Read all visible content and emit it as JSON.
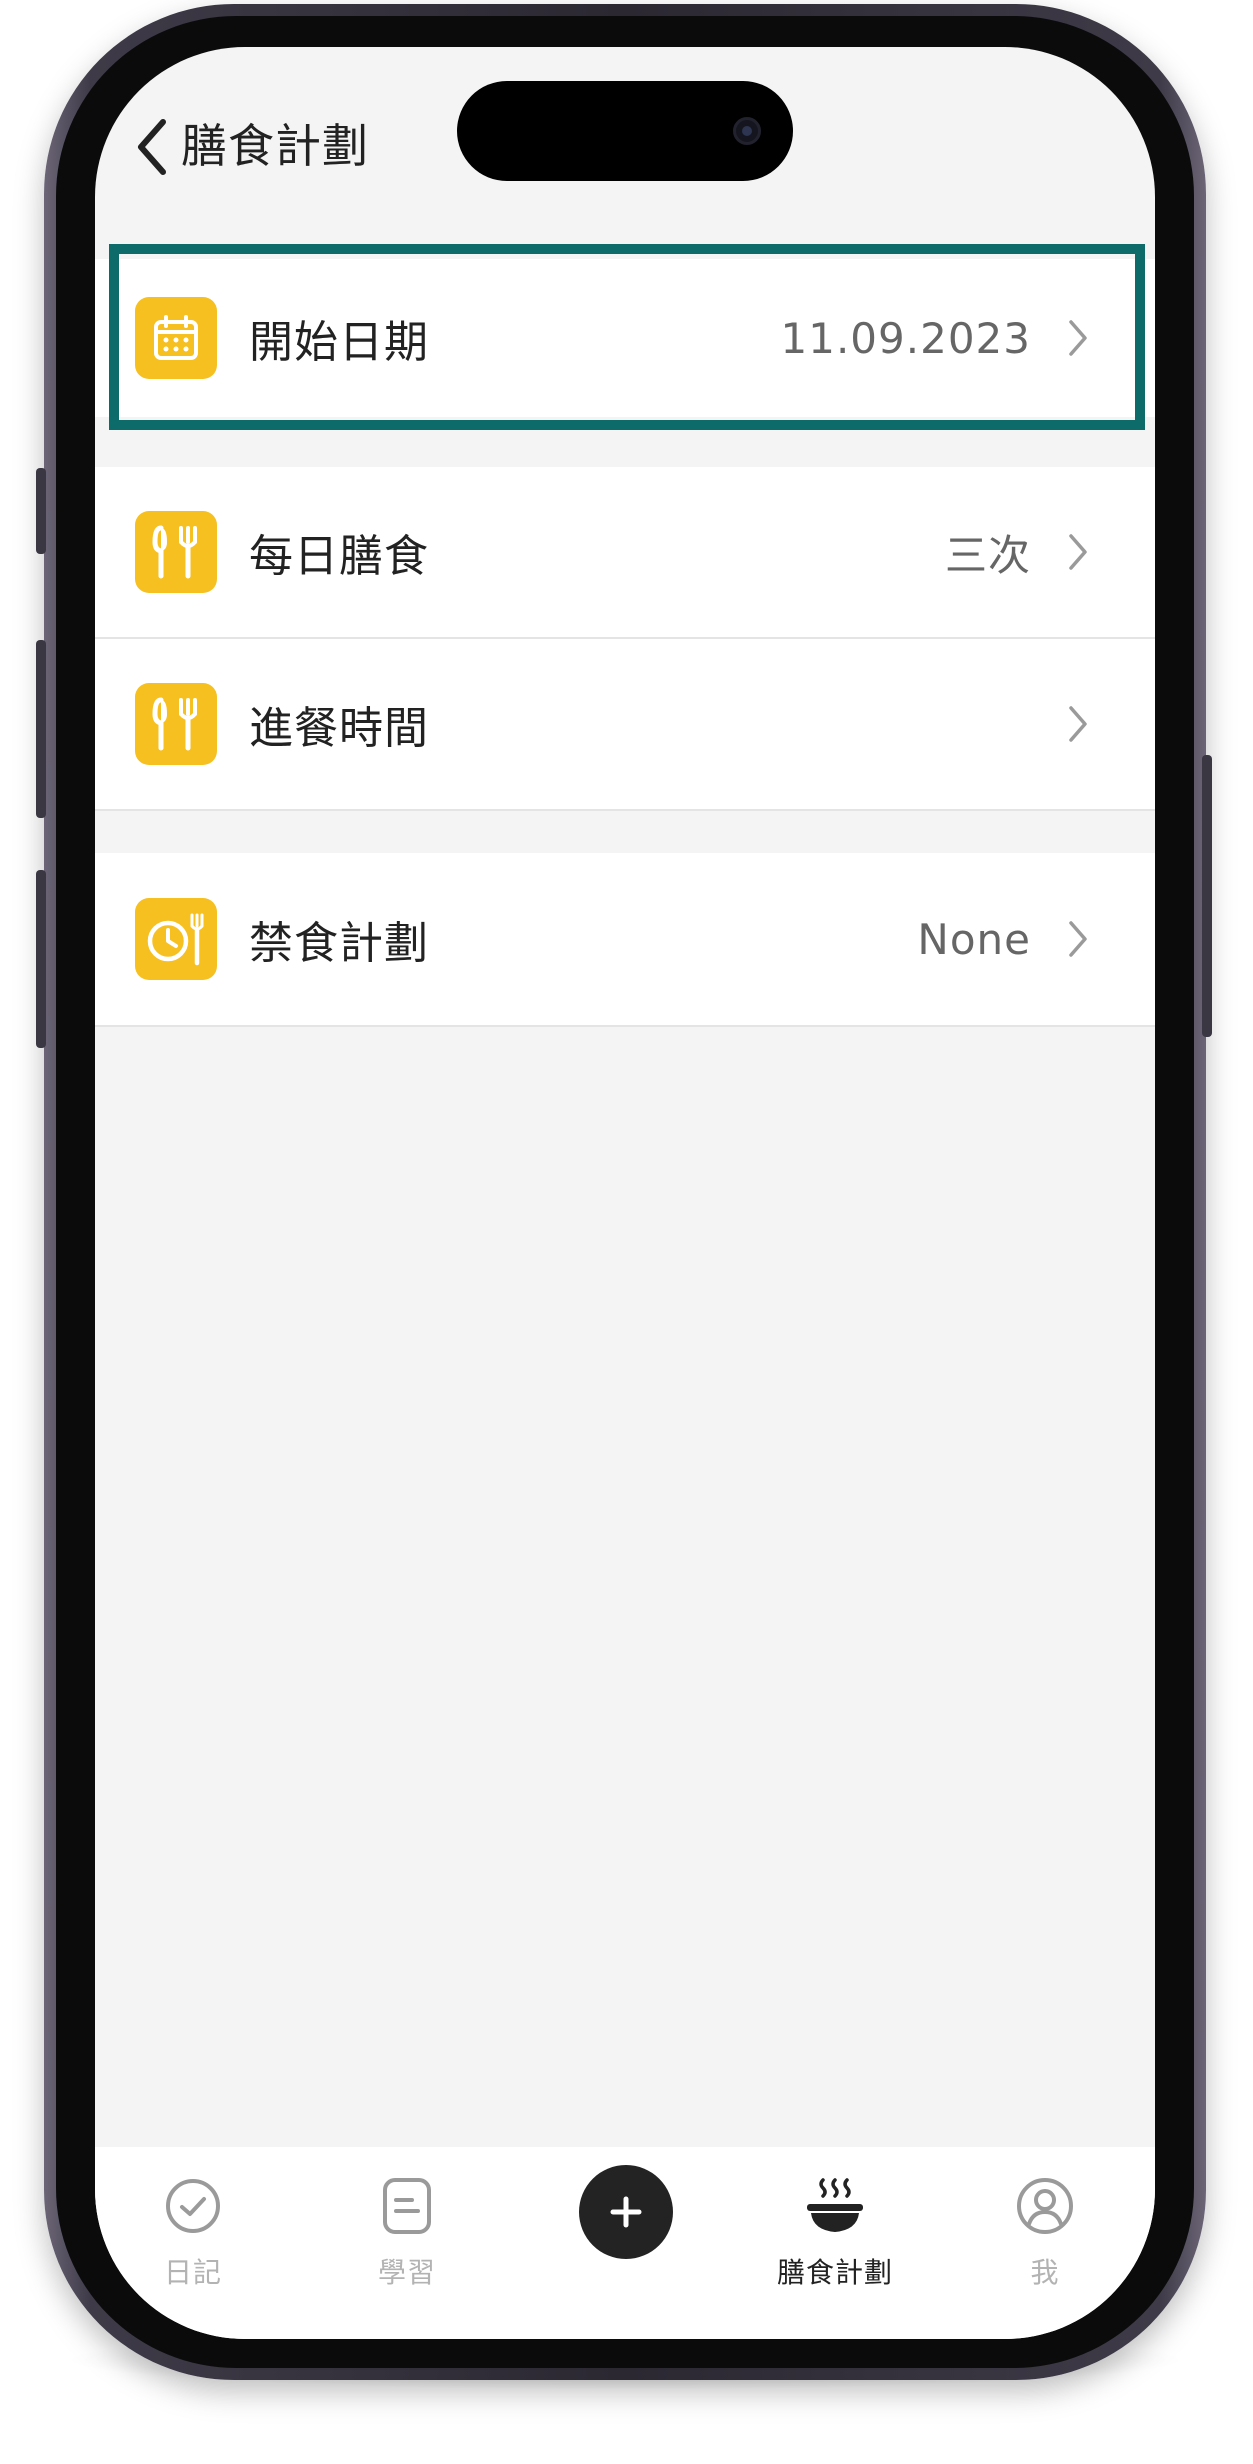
{
  "header": {
    "title": "膳食計劃"
  },
  "rows": [
    {
      "id": "start-date",
      "icon": "calendar-icon",
      "label": "開始日期",
      "value": "11.09.2023"
    },
    {
      "id": "daily-meals",
      "icon": "fork-knife-icon",
      "label": "每日膳食",
      "value": "三次"
    },
    {
      "id": "meal-time",
      "icon": "fork-knife-icon",
      "label": "進餐時間",
      "value": ""
    },
    {
      "id": "fasting-plan",
      "icon": "clock-fork-icon",
      "label": "禁食計劃",
      "value": "None"
    }
  ],
  "tabs": [
    {
      "id": "diary",
      "icon": "check-circle-icon",
      "label": "日記"
    },
    {
      "id": "learn",
      "icon": "note-icon",
      "label": "學習"
    },
    {
      "id": "add",
      "icon": "plus-icon",
      "label": ""
    },
    {
      "id": "meal-plan",
      "icon": "bowl-icon",
      "label": "膳食計劃"
    },
    {
      "id": "me",
      "icon": "person-circle-icon",
      "label": "我"
    }
  ],
  "colors": {
    "icon_bg": "#f6c021",
    "highlight": "#0d6c6a",
    "screen_bg": "#f4f4f4"
  }
}
